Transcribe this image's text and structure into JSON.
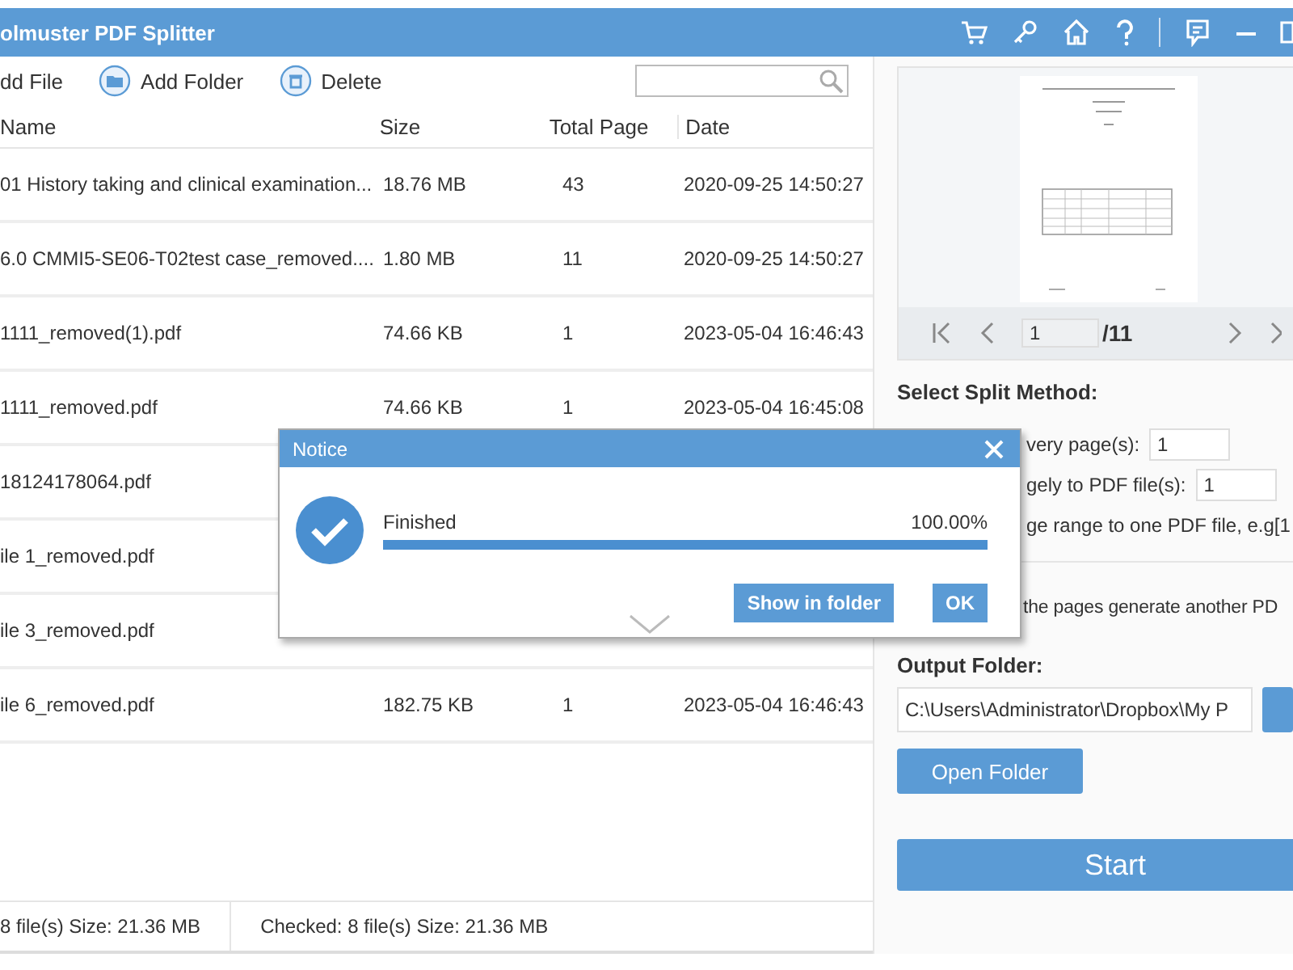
{
  "window": {
    "title": "olmuster PDF Splitter"
  },
  "toolbar": [
    {
      "label": "dd File",
      "kind": "file"
    },
    {
      "label": "Add Folder",
      "kind": "folder"
    },
    {
      "label": "Delete",
      "kind": "delete"
    }
  ],
  "table": {
    "columns": [
      "Name",
      "Size",
      "Total Page",
      "Date"
    ],
    "rows": [
      {
        "name": "01 History taking and clinical examination...",
        "size": "18.76 MB",
        "pages": "43",
        "date": "2020-09-25 14:50:27"
      },
      {
        "name": "6.0 CMMI5-SE06-T02test case_removed....",
        "size": "1.80 MB",
        "pages": "11",
        "date": "2020-09-25 14:50:27"
      },
      {
        "name": "1111_removed(1).pdf",
        "size": "74.66 KB",
        "pages": "1",
        "date": "2023-05-04 16:46:43"
      },
      {
        "name": "1111_removed.pdf",
        "size": "74.66 KB",
        "pages": "1",
        "date": "2023-05-04 16:45:08"
      },
      {
        "name": "18124178064.pdf"
      },
      {
        "name": "ile 1_removed.pdf"
      },
      {
        "name": "ile 3_removed.pdf"
      },
      {
        "name": "ile 6_removed.pdf",
        "size": "182.75 KB",
        "pages": "1",
        "date": "2023-05-04 16:46:43"
      }
    ]
  },
  "preview": {
    "page": "1",
    "total": "/11"
  },
  "split": {
    "title": "Select Split Method:",
    "options": [
      {
        "label": "very page(s):",
        "value": "1"
      },
      {
        "label": "gely to PDF file(s):",
        "value": "1"
      },
      {
        "label": "ge range to one PDF file, e.g[1"
      }
    ],
    "extra": "the pages generate another PD"
  },
  "output": {
    "title": "Output Folder:",
    "path": "C:\\Users\\Administrator\\Dropbox\\My P",
    "open": "Open Folder"
  },
  "start": "Start",
  "status": [
    "8 file(s) Size: 21.36 MB",
    "Checked: 8 file(s) Size: 21.36 MB"
  ],
  "dialog": {
    "title": "Notice",
    "message": "Finished",
    "percent": "100.00%",
    "level": 1,
    "buttons": [
      "Show in folder",
      "OK"
    ]
  }
}
